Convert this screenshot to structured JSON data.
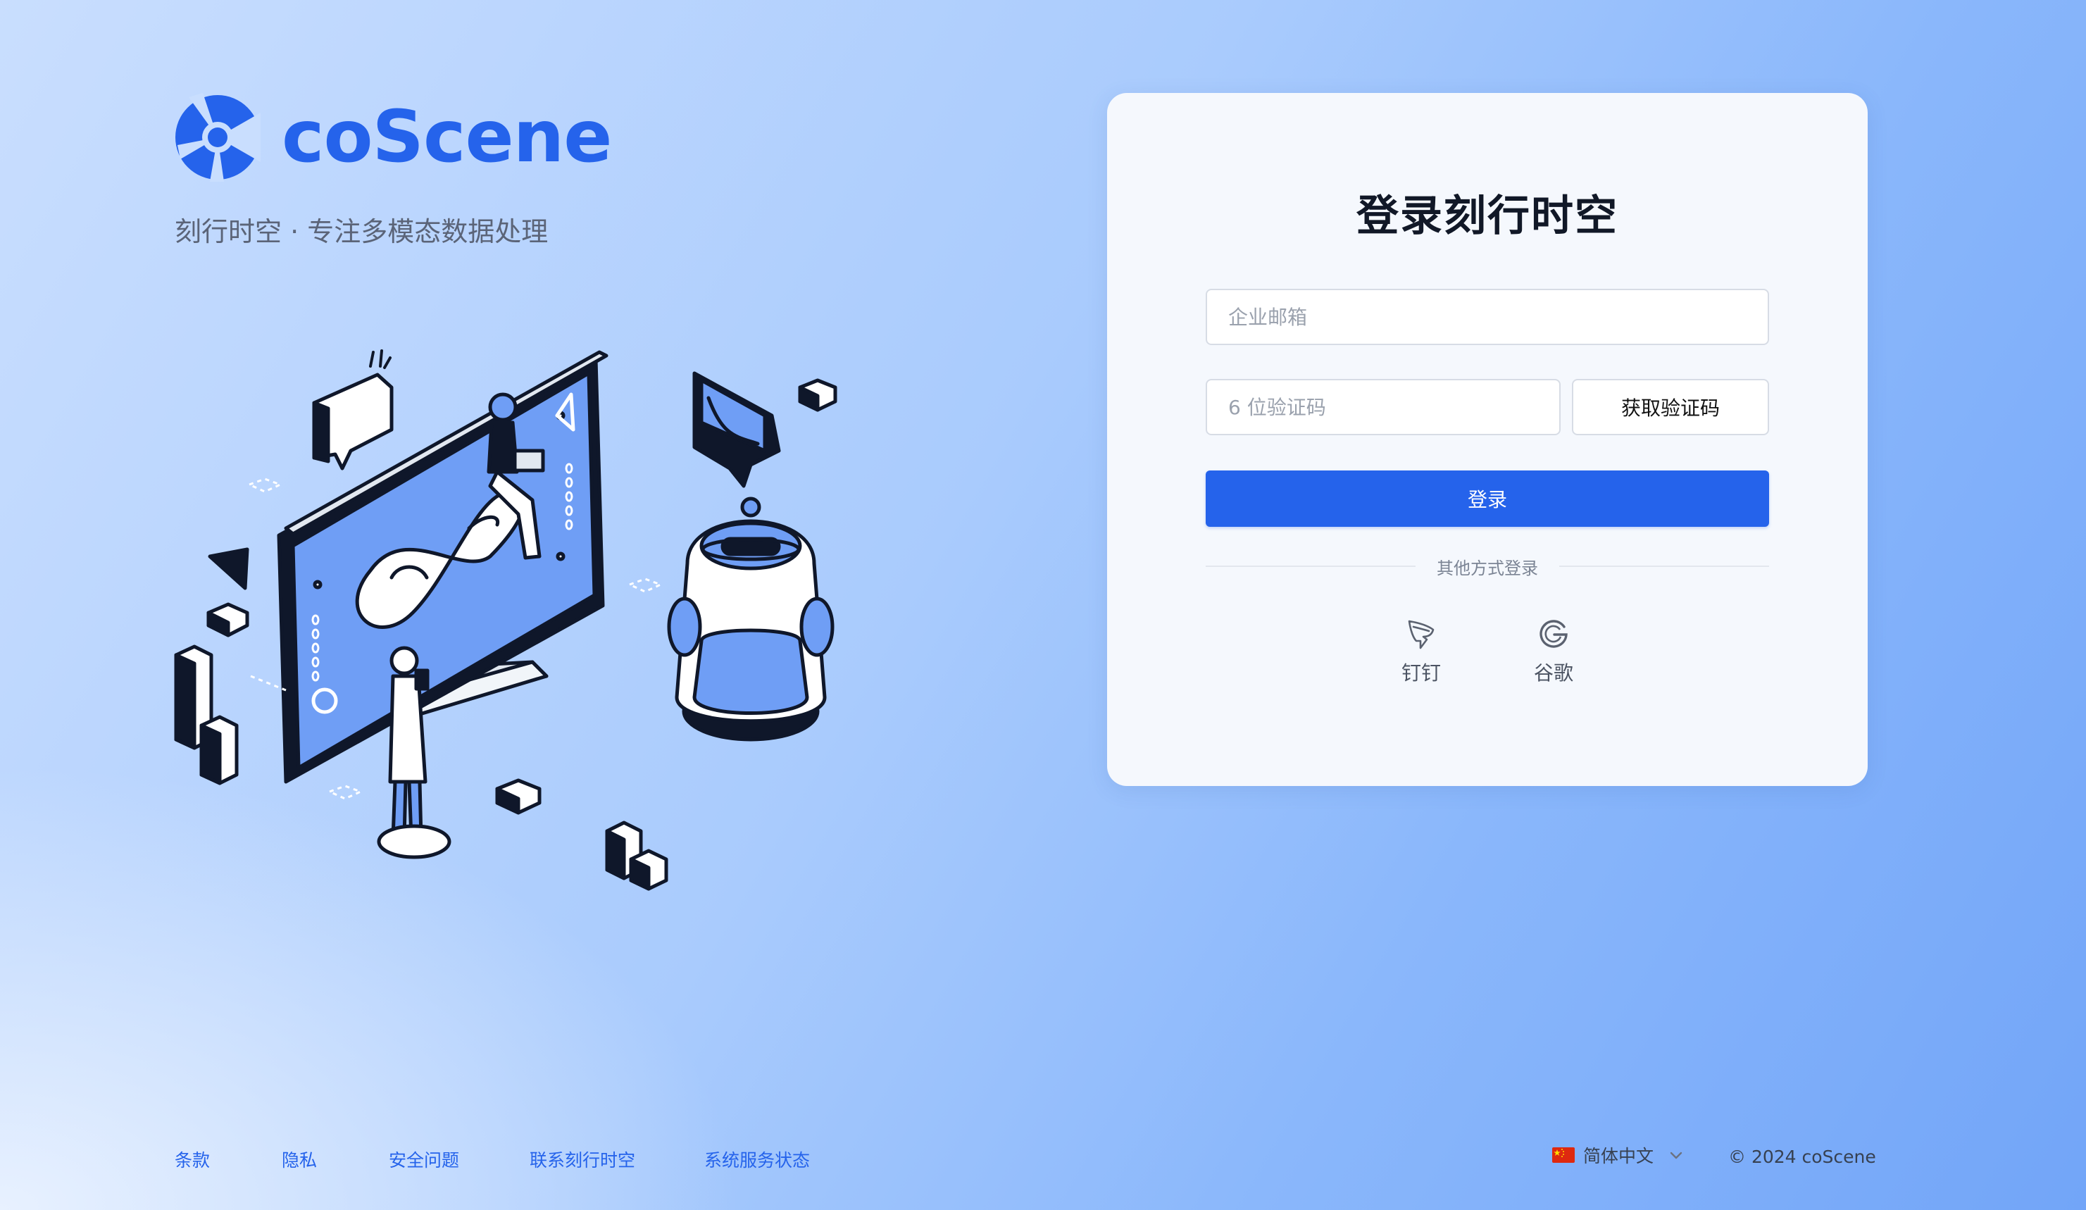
{
  "brand": {
    "name": "coScene",
    "tagline": "刻行时空 · 专注多模态数据处理",
    "brand_color": "#2563eb"
  },
  "login": {
    "title": "登录刻行时空",
    "email_placeholder": "企业邮箱",
    "code_placeholder": "6 位验证码",
    "get_code_label": "获取验证码",
    "submit_label": "登录",
    "divider_text": "其他方式登录",
    "sso": [
      {
        "label": "钉钉",
        "icon": "dingtalk-icon"
      },
      {
        "label": "谷歌",
        "icon": "google-icon"
      }
    ]
  },
  "footer": {
    "links": [
      "条款",
      "隐私",
      "安全问题",
      "联系刻行时空",
      "系统服务状态"
    ],
    "language": "简体中文",
    "copyright": "© 2024 coScene"
  }
}
